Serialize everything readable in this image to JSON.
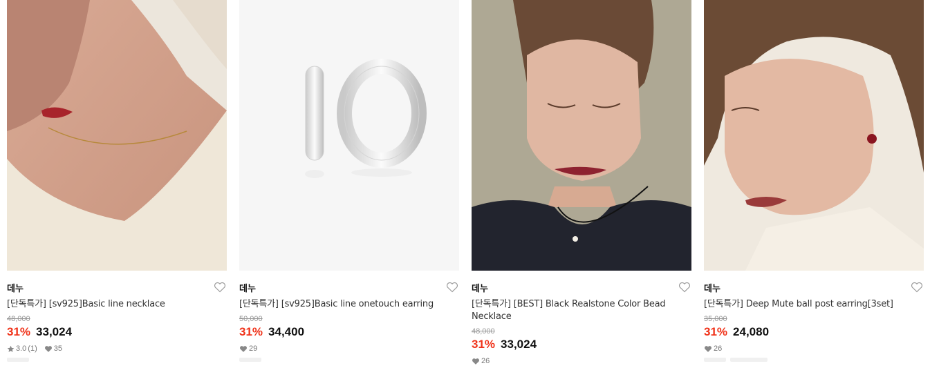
{
  "products": [
    {
      "image_alt": "necklace-model-photo",
      "brand": "데누",
      "title": "[단독특가] [sv925]Basic line necklace",
      "original_price": "48,000",
      "discount": "31%",
      "price": "33,024",
      "rating": "3.0",
      "review_count": "(1)",
      "likes": "35"
    },
    {
      "image_alt": "hoop-earring-product-photo",
      "brand": "데누",
      "title": "[단독특가] [sv925]Basic line onetouch earring",
      "original_price": "50,000",
      "discount": "31%",
      "price": "34,400",
      "likes": "29"
    },
    {
      "image_alt": "bead-necklace-model-photo",
      "brand": "데누",
      "title": "[단독특가] [BEST] Black Realstone Color Bead Necklace",
      "original_price": "48,000",
      "discount": "31%",
      "price": "33,024",
      "likes": "26"
    },
    {
      "image_alt": "ball-earring-model-photo",
      "brand": "데누",
      "title": "[단독특가] Deep Mute ball post earring[3set]",
      "original_price": "35,000",
      "discount": "31%",
      "price": "24,080",
      "likes": "26"
    }
  ],
  "icons": {
    "wishlist": "heart-outline-icon",
    "rating": "star-icon",
    "likes": "heart-filled-icon"
  },
  "colors": {
    "discount": "#f0331a",
    "price": "#111111",
    "original_price": "#999999"
  }
}
